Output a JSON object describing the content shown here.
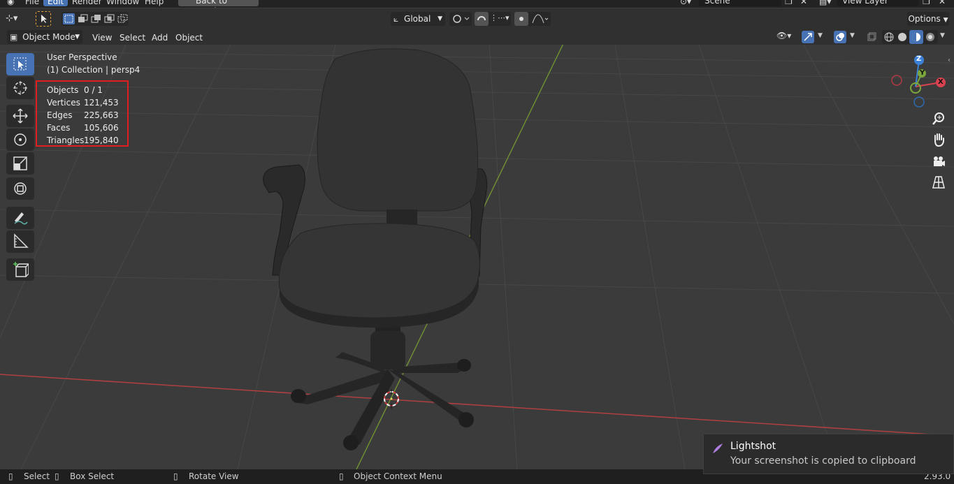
{
  "menu": {
    "file": "File",
    "edit": "Edit",
    "render": "Render",
    "window": "Window",
    "help": "Help",
    "back_to_previous": "Back to Previous",
    "scene": "Scene",
    "view_layer": "View Layer"
  },
  "header": {
    "transform_orientation": "Global",
    "options": "Options"
  },
  "header2": {
    "mode": "Object Mode",
    "view": "View",
    "select": "Select",
    "add": "Add",
    "object": "Object"
  },
  "overlay": {
    "perspective": "User Perspective",
    "collection": "(1) Collection | persp4",
    "stats": [
      {
        "label": "Objects",
        "value": "0 / 1"
      },
      {
        "label": "Vertices",
        "value": "121,453"
      },
      {
        "label": "Edges",
        "value": "225,663"
      },
      {
        "label": "Faces",
        "value": "105,606"
      },
      {
        "label": "Triangles",
        "value": "195,840"
      }
    ]
  },
  "gizmo": {
    "x": "X",
    "y": "Y",
    "z": "Z"
  },
  "statusbar": {
    "select": "Select",
    "box_select": "Box Select",
    "rotate_view": "Rotate View",
    "context_menu": "Object Context Menu",
    "version": "2.93.0"
  },
  "notification": {
    "title": "Lightshot",
    "message": "Your screenshot is copied to clipboard"
  },
  "colors": {
    "accent": "#4772b3",
    "x_axis": "#d9434f",
    "y_axis": "#7ba63c",
    "z_axis": "#3b82d6",
    "stats_border": "#e01e1e"
  }
}
